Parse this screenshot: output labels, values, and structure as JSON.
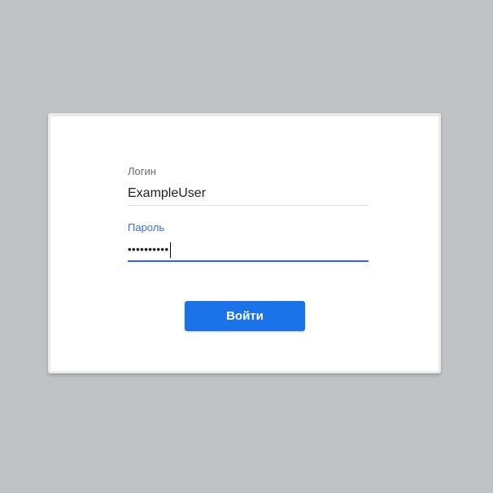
{
  "login_form": {
    "login_label": "Логин",
    "login_value": "ExampleUser",
    "password_label": "Пароль",
    "password_value": "••••••••••",
    "submit_label": "Войти"
  },
  "colors": {
    "background": "#c0c3c6",
    "accent": "#1a73e8",
    "focus_label": "#3b6fd1"
  }
}
